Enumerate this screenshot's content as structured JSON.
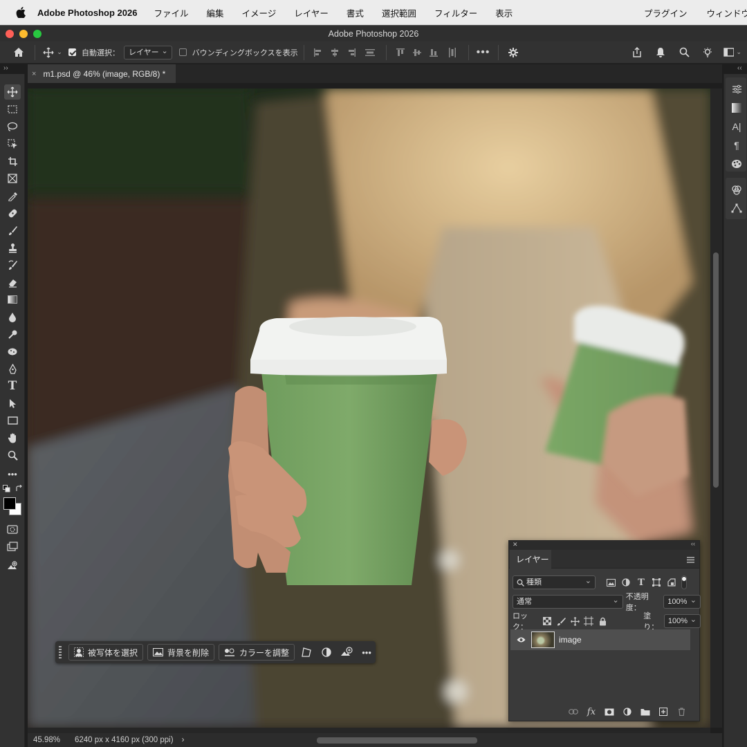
{
  "menubar": {
    "app_name": "Adobe Photoshop 2026",
    "items": [
      "ファイル",
      "編集",
      "イメージ",
      "レイヤー",
      "書式",
      "選択範囲",
      "フィルター",
      "表示"
    ],
    "right_items": [
      "プラグイン",
      "ウィンドウ"
    ]
  },
  "window": {
    "title": "Adobe Photoshop 2026",
    "traffic_colors": [
      "#fe5f57",
      "#febc2e",
      "#28c840"
    ]
  },
  "options_bar": {
    "auto_select_label": "自動選択：",
    "auto_select_checked": true,
    "auto_select_target": "レイヤー",
    "bounding_box_label": "バウンディングボックスを表示",
    "bounding_box_checked": false
  },
  "document": {
    "tab_label": "m1.psd @ 46% (image, RGB/8) *",
    "close_glyph": "×"
  },
  "status": {
    "zoom": "45.98%",
    "info": "6240 px x 4160 px (300 ppi)",
    "arrow": "›"
  },
  "taskbar": {
    "select_subject": "被写体を選択",
    "remove_background": "背景を削除",
    "adjust_color": "カラーを調整"
  },
  "layers_panel": {
    "tab": "レイヤー",
    "filter_kind": "種類",
    "blend_mode": "通常",
    "opacity_label": "不透明度：",
    "opacity_value": "100%",
    "lock_label": "ロック：",
    "fill_label": "塗り：",
    "fill_value": "100%",
    "layers": [
      {
        "name": "image",
        "visible": true
      }
    ]
  },
  "colors": {
    "accent_select": "#4f4f4f",
    "foreground": "#000000",
    "background": "#ffffff"
  }
}
